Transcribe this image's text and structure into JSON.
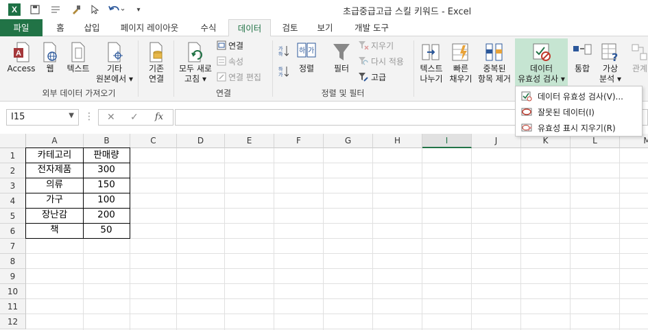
{
  "window": {
    "title": "초급중급고급 스킬 키워드 - Excel",
    "logo_letter": "X"
  },
  "tabs": [
    {
      "label": "파일"
    },
    {
      "label": "홈"
    },
    {
      "label": "삽입"
    },
    {
      "label": "페이지 레이아웃"
    },
    {
      "label": "수식"
    },
    {
      "label": "데이터"
    },
    {
      "label": "검토"
    },
    {
      "label": "보기"
    },
    {
      "label": "개발 도구"
    }
  ],
  "ribbon": {
    "external": {
      "group_label": "외부 데이터 가져오기",
      "access": "Access",
      "web": "웹",
      "text": "텍스트",
      "other_line1": "기타",
      "other_line2": "원본에서"
    },
    "existing": {
      "line1": "기존",
      "line2": "연결"
    },
    "connections": {
      "group_label": "연결",
      "refresh_line1": "모두 새로",
      "refresh_line2": "고침",
      "connections": "연결",
      "properties": "속성",
      "edit_links": "연결 편집"
    },
    "sort_filter": {
      "group_label": "정렬 및 필터",
      "sort": "정렬",
      "filter": "필터",
      "clear": "지우기",
      "reapply": "다시 적용",
      "advanced": "고급"
    },
    "tools": {
      "text_to_columns_line1": "텍스트",
      "text_to_columns_line2": "나누기",
      "flash_fill_line1": "빠른",
      "flash_fill_line2": "채우기",
      "remove_dup_line1": "중복된",
      "remove_dup_line2": "항목 제거",
      "validation_line1": "데이터",
      "validation_line2": "유효성 검사",
      "consolidate": "통합",
      "whatif_line1": "가상",
      "whatif_line2": "분석",
      "relations": "관계"
    }
  },
  "menu": {
    "items": [
      {
        "label": "데이터 유효성 검사(V)..."
      },
      {
        "label": "잘못된 데이터(I)"
      },
      {
        "label": "유효성 표시 지우기(R)"
      }
    ]
  },
  "formula_bar": {
    "name_box": "I15",
    "fx": "fx",
    "cancel": "✕",
    "enter": "✓",
    "content": ""
  },
  "grid": {
    "columns": [
      "A",
      "B",
      "C",
      "D",
      "E",
      "F",
      "G",
      "H",
      "I",
      "J",
      "K",
      "L",
      "M"
    ],
    "rows": [
      "1",
      "2",
      "3",
      "4",
      "5",
      "6",
      "7",
      "8",
      "9",
      "10",
      "11",
      "12"
    ],
    "selected_column": "I",
    "table": {
      "header": [
        "카테고리",
        "판매량"
      ],
      "rows": [
        [
          "전자제품",
          "300"
        ],
        [
          "의류",
          "150"
        ],
        [
          "가구",
          "100"
        ],
        [
          "장난감",
          "200"
        ],
        [
          "책",
          "50"
        ]
      ]
    }
  },
  "colors": {
    "accent": "#217346",
    "highlight": "#c6e5d2",
    "ribbon_bg": "#f3f3f3"
  }
}
